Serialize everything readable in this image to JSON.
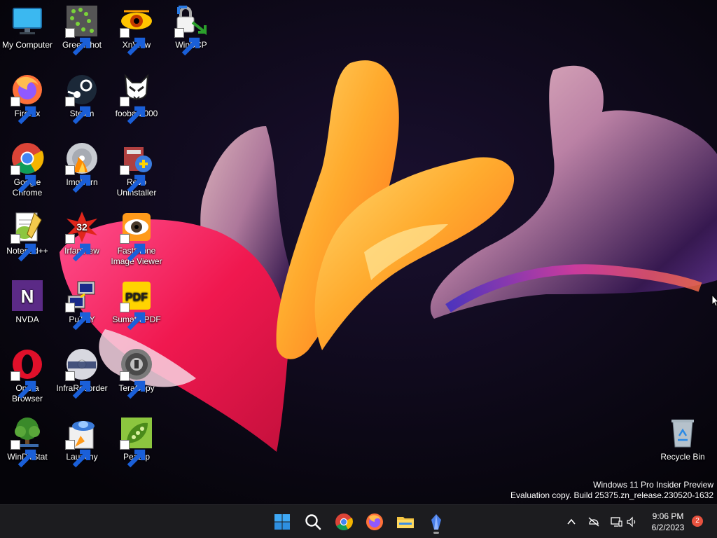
{
  "desktop": {
    "icons": [
      {
        "label": "My Computer",
        "icon": "monitor-icon",
        "shortcut": false
      },
      {
        "label": "Greenshot",
        "icon": "greenshot-icon",
        "shortcut": true
      },
      {
        "label": "XnView",
        "icon": "xnview-icon",
        "shortcut": true
      },
      {
        "label": "WinSCP",
        "icon": "winscp-icon",
        "shortcut": true
      },
      {
        "label": "Firefox",
        "icon": "firefox-icon",
        "shortcut": true
      },
      {
        "label": "Steam",
        "icon": "steam-icon",
        "shortcut": true
      },
      {
        "label": "foobar2000",
        "icon": "foobar2000-icon",
        "shortcut": true
      },
      {
        "label": "Google Chrome",
        "icon": "chrome-icon",
        "shortcut": true
      },
      {
        "label": "ImgBurn",
        "icon": "imgburn-icon",
        "shortcut": true
      },
      {
        "label": "Revo Uninstaller",
        "icon": "revo-uninstaller-icon",
        "shortcut": true
      },
      {
        "label": "Notepad++",
        "icon": "notepadpp-icon",
        "shortcut": true
      },
      {
        "label": "IrfanView",
        "icon": "irfanview-icon",
        "shortcut": true
      },
      {
        "label": "FastStone Image Viewer",
        "icon": "faststone-icon",
        "shortcut": true
      },
      {
        "label": "NVDA",
        "icon": "nvda-icon",
        "shortcut": false
      },
      {
        "label": "PuTTY",
        "icon": "putty-icon",
        "shortcut": true
      },
      {
        "label": "SumatraPDF",
        "icon": "sumatrapdf-icon",
        "shortcut": true
      },
      {
        "label": "Opera Browser",
        "icon": "opera-icon",
        "shortcut": true
      },
      {
        "label": "InfraRecorder",
        "icon": "infrarecorder-icon",
        "shortcut": true
      },
      {
        "label": "TeraCopy",
        "icon": "teracopy-icon",
        "shortcut": true
      },
      {
        "label": "WinDirStat",
        "icon": "windirstat-icon",
        "shortcut": true
      },
      {
        "label": "Launchy",
        "icon": "launchy-icon",
        "shortcut": true
      },
      {
        "label": "PeaZip",
        "icon": "peazip-icon",
        "shortcut": true
      },
      {
        "label": "Recycle Bin",
        "icon": "recycle-bin-icon",
        "shortcut": false
      }
    ],
    "watermark": {
      "line1": "Windows 11 Pro Insider Preview",
      "line2": "Evaluation copy. Build 25375.zn_release.230520-1632"
    }
  },
  "taskbar": {
    "apps": [
      {
        "name": "start",
        "icon": "windows-start-icon"
      },
      {
        "name": "search",
        "icon": "search-icon"
      },
      {
        "name": "chrome",
        "icon": "chrome-icon"
      },
      {
        "name": "firefox",
        "icon": "firefox-icon"
      },
      {
        "name": "file-explorer",
        "icon": "folder-icon"
      },
      {
        "name": "app",
        "icon": "crystal-icon"
      }
    ],
    "tray": {
      "icons": [
        "chevron-up-icon",
        "network-disconnected-icon",
        "display-icon",
        "speaker-icon"
      ],
      "time": "9:06 PM",
      "date": "6/2/2023",
      "notifications": "2"
    }
  },
  "colors": {
    "taskbar_bg": "#1c1c1f",
    "desktop_bg": "#07060f",
    "badge": "#e8523f"
  }
}
